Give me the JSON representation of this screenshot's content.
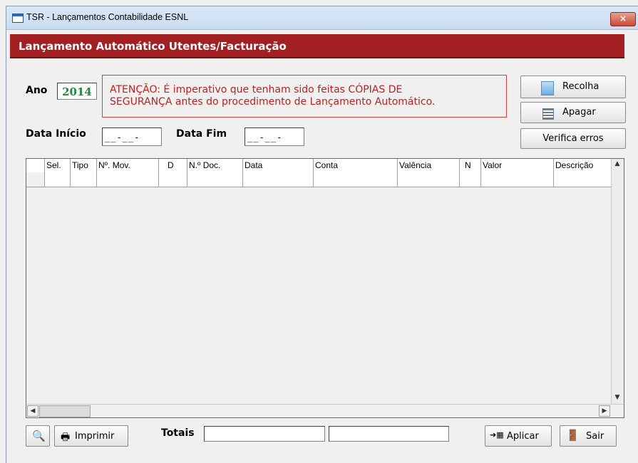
{
  "window": {
    "title": "TSR - Lançamentos Contabilidade ESNL",
    "close_label": "×"
  },
  "header": {
    "title": "Lançamento Automático Utentes/Facturação"
  },
  "filters": {
    "ano_label": "Ano",
    "ano_value": "2014",
    "data_inicio_label": "Data Início",
    "data_inicio_value": "__-__-____",
    "data_fim_label": "Data Fim",
    "data_fim_value": "__-__-____"
  },
  "warning": {
    "line1": "ATENÇÃO: É imperativo que tenham sido feitas CÓPIAS DE",
    "line2": "SEGURANÇA antes do procedimento de Lançamento Automático."
  },
  "actions": {
    "recolha": "Recolha",
    "apagar": "Apagar",
    "verifica_erros": "Verifica erros"
  },
  "grid": {
    "columns": [
      "",
      "Sel.",
      "Tipo",
      "Nº. Mov.",
      "D",
      "N.º Doc.",
      "Data",
      "Conta",
      "Valência",
      "N",
      "Valor",
      "Descrição"
    ]
  },
  "footer": {
    "imprimir": "Imprimir",
    "totais_label": "Totais",
    "totais_value1": "",
    "totais_value2": "",
    "aplicar": "Aplicar",
    "sair": "Sair"
  },
  "colors": {
    "header_band": "#a21f22",
    "warning_text": "#c0201f",
    "ano_text": "#1f8a3a"
  }
}
